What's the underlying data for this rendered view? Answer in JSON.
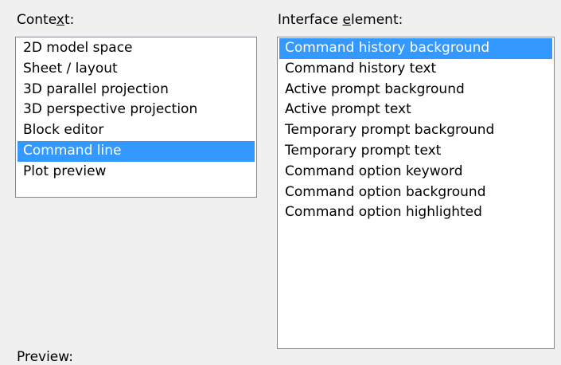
{
  "context": {
    "label_pre": "Conte",
    "label_accel": "x",
    "label_post": "t:",
    "items": [
      {
        "label": "2D model space",
        "selected": false
      },
      {
        "label": "Sheet / layout",
        "selected": false
      },
      {
        "label": "3D parallel projection",
        "selected": false
      },
      {
        "label": "3D perspective projection",
        "selected": false
      },
      {
        "label": "Block editor",
        "selected": false
      },
      {
        "label": "Command line",
        "selected": true
      },
      {
        "label": "Plot preview",
        "selected": false
      }
    ]
  },
  "interface_element": {
    "label_pre": "Interface ",
    "label_accel": "e",
    "label_post": "lement:",
    "items": [
      {
        "label": "Command history background",
        "selected": true
      },
      {
        "label": "Command history text",
        "selected": false
      },
      {
        "label": "Active prompt background",
        "selected": false
      },
      {
        "label": "Active prompt text",
        "selected": false
      },
      {
        "label": "Temporary prompt background",
        "selected": false
      },
      {
        "label": "Temporary prompt text",
        "selected": false
      },
      {
        "label": "Command option keyword",
        "selected": false
      },
      {
        "label": "Command option background",
        "selected": false
      },
      {
        "label": "Command option highlighted",
        "selected": false
      }
    ]
  },
  "preview": {
    "label": "Preview:"
  },
  "colors": {
    "selection_bg": "#3399ff",
    "selection_text": "#ffffff",
    "dialog_bg": "#f0f0f0",
    "list_border": "#828790"
  }
}
